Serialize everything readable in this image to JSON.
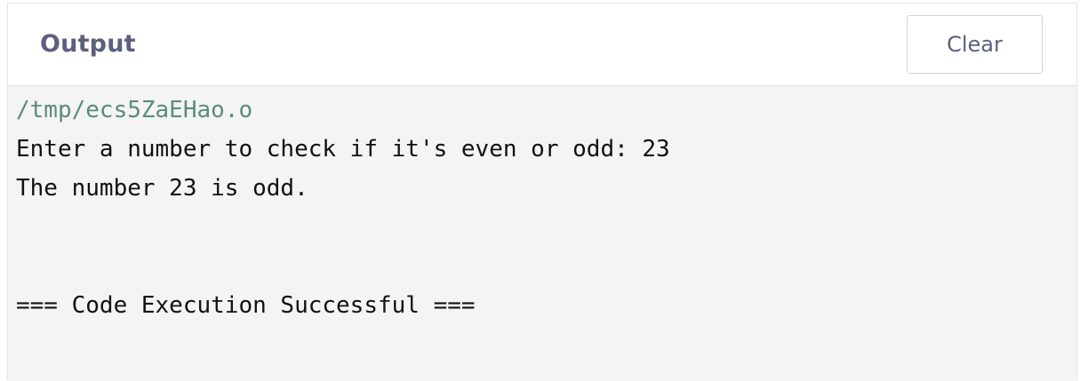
{
  "header": {
    "title": "Output",
    "clear_label": "Clear"
  },
  "output": {
    "lines": [
      "/tmp/ecs5ZaEHao.o",
      "Enter a number to check if it's even or odd: 23",
      "The number 23 is odd.",
      "",
      "",
      "=== Code Execution Successful ==="
    ]
  },
  "colors": {
    "path_text": "#5b8c7a",
    "output_background": "#f4f4f4",
    "header_text": "#5c5f7e"
  }
}
